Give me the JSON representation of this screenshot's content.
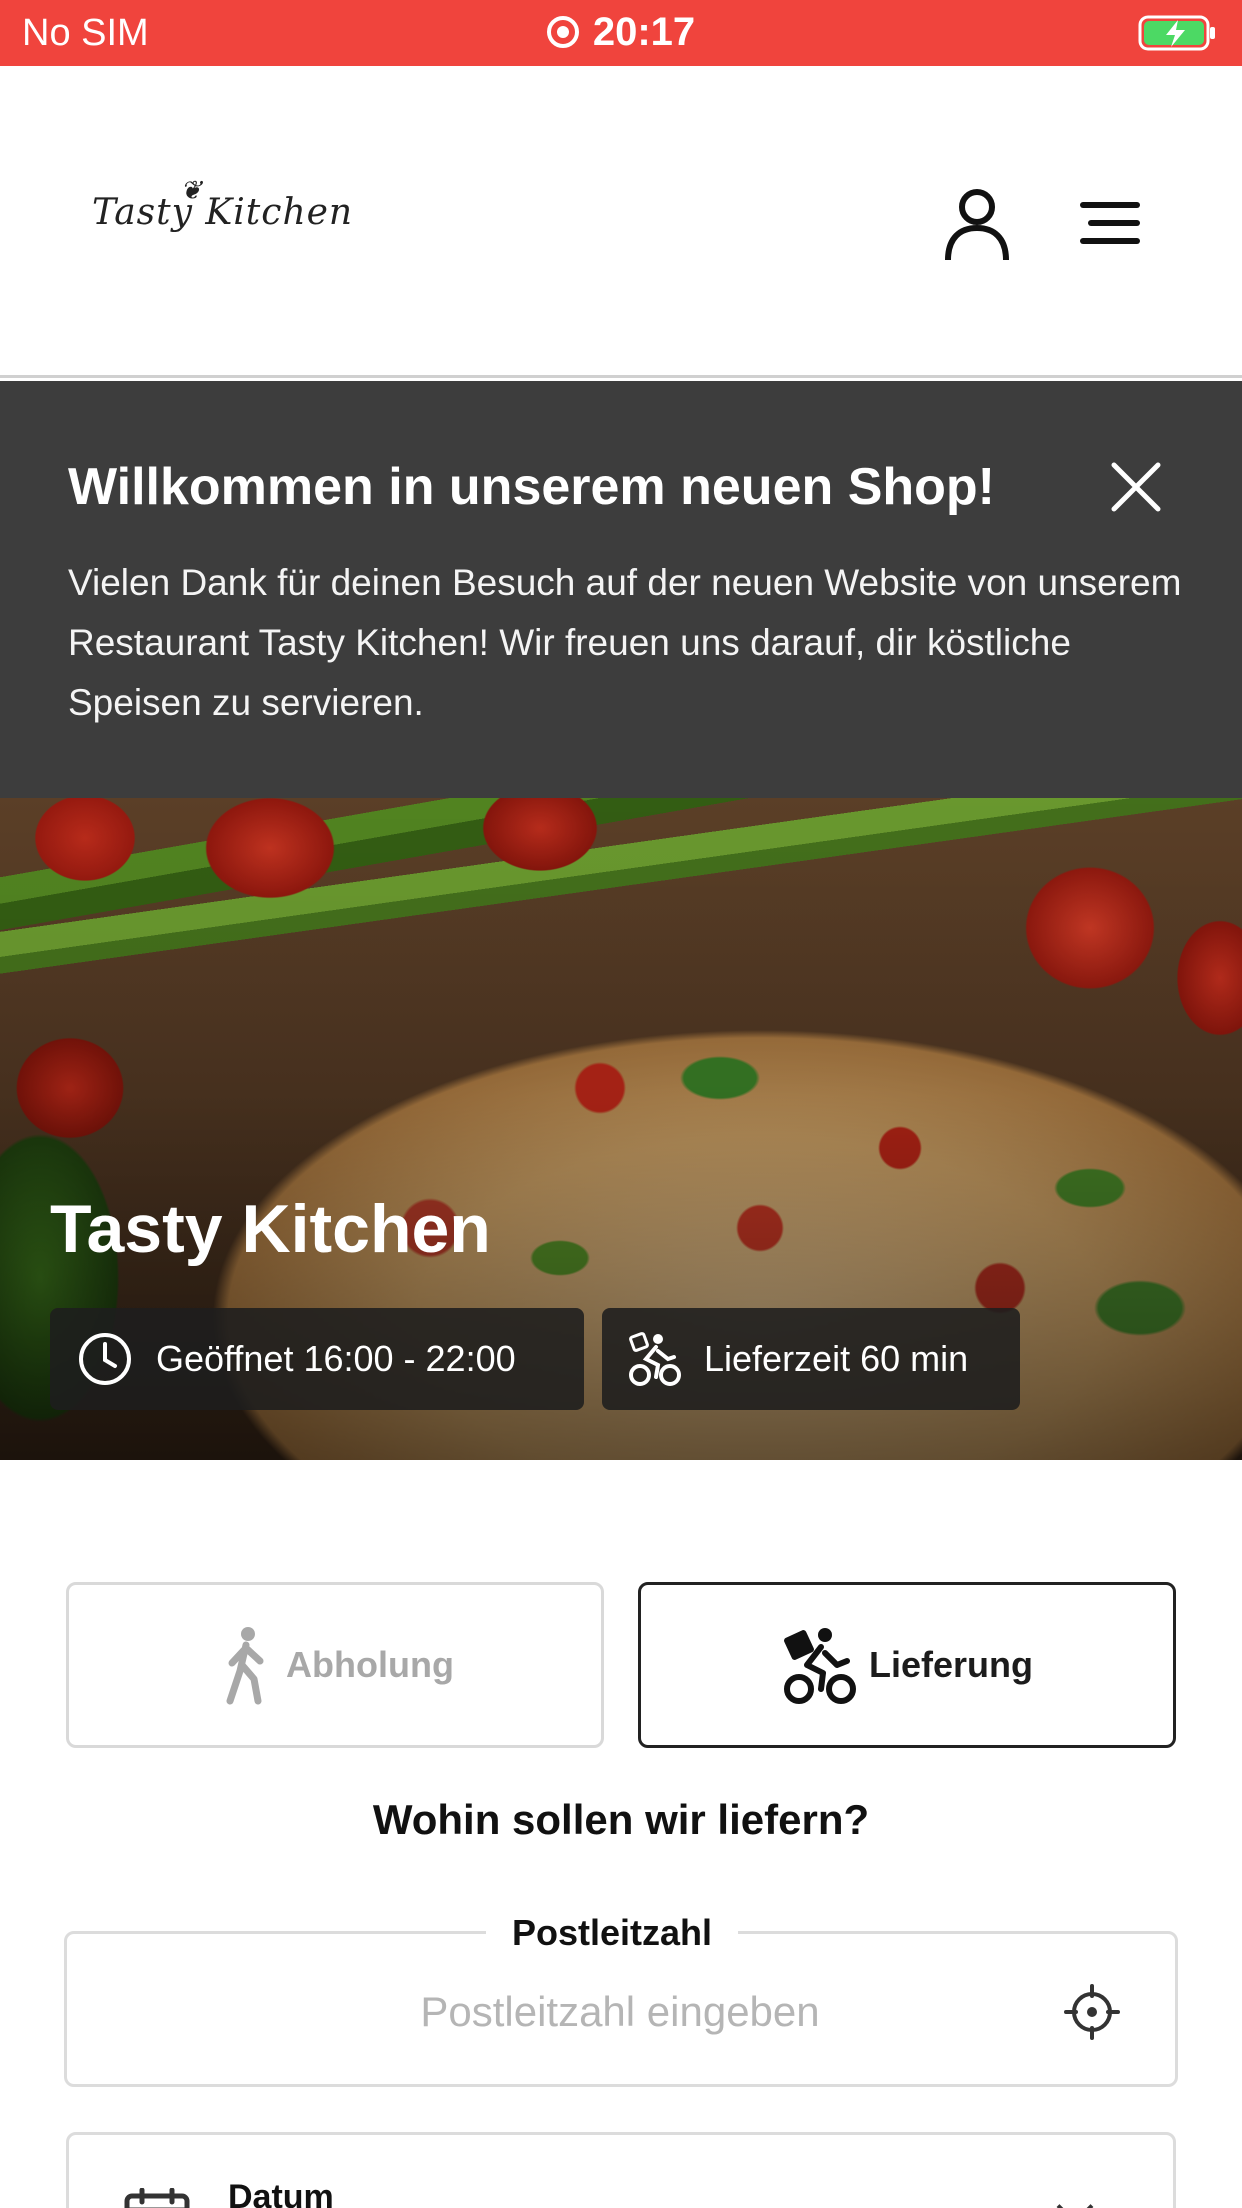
{
  "status_bar": {
    "carrier": "No SIM",
    "time": "20:17",
    "accent_color": "#f0443d"
  },
  "header": {
    "logo_text": "Tasty Kitchen",
    "icons": [
      "user-icon",
      "menu-icon"
    ]
  },
  "banner": {
    "title": "Willkommen in unserem neuen Shop!",
    "text": "Vielen Dank für deinen Besuch auf der neuen Website von unserem Restaurant Tasty Kitchen! Wir freuen uns darauf, dir köstliche Speisen zu servieren.",
    "background": "#3d3d3d"
  },
  "hero": {
    "title": "Tasty Kitchen",
    "hours": "Geöffnet 16:00 - 22:00",
    "delivery_time": "Lieferzeit 60 min"
  },
  "order_type": {
    "pickup_label": "Abholung",
    "delivery_label": "Lieferung",
    "selected": "Lieferung"
  },
  "delivery": {
    "question": "Wohin sollen wir liefern?",
    "zip_label": "Postleitzahl",
    "zip_placeholder": "Postleitzahl eingeben",
    "zip_value": "",
    "date_label": "Datum"
  }
}
